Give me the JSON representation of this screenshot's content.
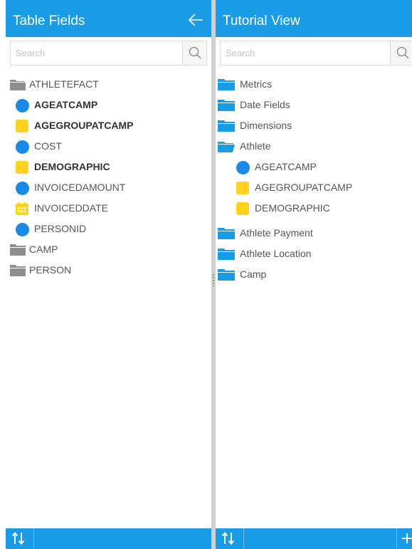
{
  "left_panel": {
    "title": "Table Fields",
    "search_placeholder": "Search",
    "folder": "ATHLETEFACT",
    "fields": [
      {
        "label": "AGEATCAMP",
        "icon": "metric-circle-icon"
      },
      {
        "label": "AGEGROUPATCAMP",
        "icon": "dimension-square-icon"
      },
      {
        "label": "COST",
        "icon": "metric-circle-icon"
      },
      {
        "label": "DEMOGRAPHIC",
        "icon": "dimension-square-icon"
      },
      {
        "label": "INVOICEDAMOUNT",
        "icon": "metric-circle-icon"
      },
      {
        "label": "INVOICEDDATE",
        "icon": "calendar-icon"
      },
      {
        "label": "PERSONID",
        "icon": "metric-circle-icon"
      }
    ],
    "other_folders": [
      "CAMP",
      "PERSON"
    ]
  },
  "right_panel": {
    "title": "Tutorial View",
    "search_placeholder": "Search",
    "folders_top": [
      "Metrics",
      "Date Fields",
      "Dimensions",
      "Athlete"
    ],
    "athlete_fields": [
      {
        "label": "AGEATCAMP",
        "icon": "metric-circle-icon"
      },
      {
        "label": "AGEGROUPATCAMP",
        "icon": "dimension-square-icon"
      },
      {
        "label": "DEMOGRAPHIC",
        "icon": "dimension-square-icon"
      }
    ],
    "folders_bottom": [
      "Athlete Payment",
      "Athlete Location",
      "Camp"
    ]
  },
  "colors": {
    "accent": "#1a9be6",
    "metric": "#1a8ae6",
    "dimension": "#ffd21f",
    "folder_grey": "#8e8e8e",
    "folder_blue": "#1a9be6"
  }
}
